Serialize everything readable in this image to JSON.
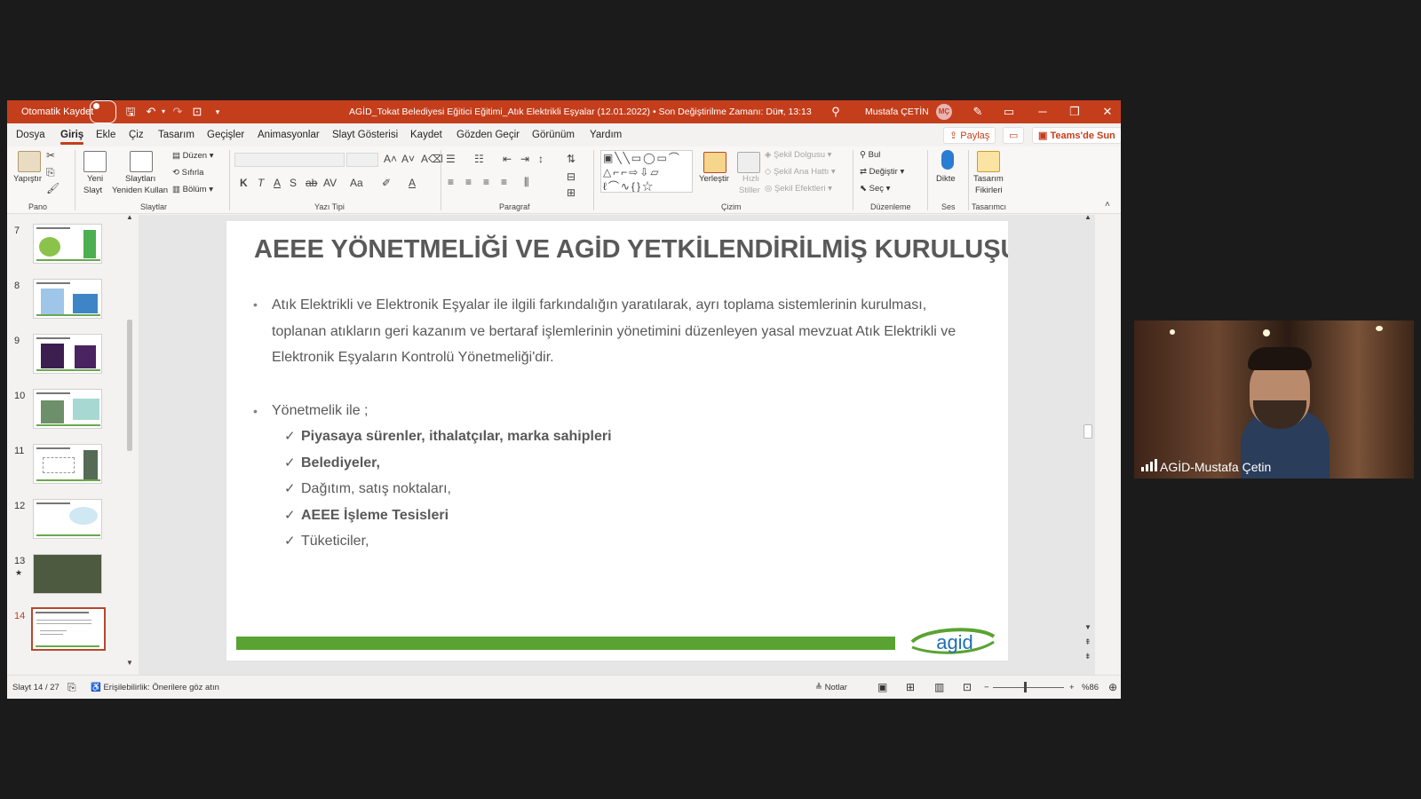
{
  "titlebar": {
    "autosave_label": "Otomatik Kaydet",
    "doc_title": "AGİD_Tokat Belediyesi Eğitici Eğitimi_Atık Elektrikli Eşyalar (12.01.2022) • Son Değiştirilme Zamanı: Dün, 13:13",
    "user_name": "Mustafa ÇETİN",
    "user_initials": "MÇ"
  },
  "menu": {
    "tabs": [
      "Dosya",
      "Giriş",
      "Ekle",
      "Çiz",
      "Tasarım",
      "Geçişler",
      "Animasyonlar",
      "Slayt Gösterisi",
      "Kaydet",
      "Gözden Geçir",
      "Görünüm",
      "Yardım"
    ],
    "share_label": "Paylaş",
    "teams_label": "Teams'de Sun"
  },
  "ribbon": {
    "paste_label": "Yapıştır",
    "new_slide_l1": "Yeni",
    "new_slide_l2": "Slayt",
    "reuse_l1": "Slaytları",
    "reuse_l2": "Yeniden Kullan",
    "layout_label": "Düzen",
    "reset_label": "Sıfırla",
    "section_label": "Bölüm",
    "shape_fill": "Şekil Dolgusu",
    "shape_outline": "Şekil Ana Hattı",
    "shape_effects": "Şekil Efektleri",
    "arrange_label": "Yerleştir",
    "quick_styles_l1": "Hızlı",
    "quick_styles_l2": "Stiller",
    "find_label": "Bul",
    "replace_label": "Değiştir",
    "select_label": "Seç",
    "dictate_label": "Dikte",
    "designer_l1": "Tasarım",
    "designer_l2": "Fikirleri",
    "groups": {
      "pano": "Pano",
      "slaytlar": "Slaytlar",
      "yazi_tipi": "Yazı Tipi",
      "paragraf": "Paragraf",
      "cizim": "Çizim",
      "duzenleme": "Düzenleme",
      "ses": "Ses",
      "tasarimci": "Tasarımcı"
    }
  },
  "thumbnails": [
    {
      "num": "7"
    },
    {
      "num": "8"
    },
    {
      "num": "9"
    },
    {
      "num": "10"
    },
    {
      "num": "11"
    },
    {
      "num": "12"
    },
    {
      "num": "13"
    },
    {
      "num": "14"
    }
  ],
  "slide": {
    "title": "AEEE YÖNETMELİĞİ VE AGİD YETKİLENDİRİLMİŞ KURULUŞU",
    "bullet1_line1": "Atık Elektrikli ve Elektronik Eşyalar ile ilgili farkındalığın yaratılarak, ayrı toplama sistemlerinin kurulması,",
    "bullet1_line2": "toplanan atıkların geri kazanım ve bertaraf işlemlerinin yönetimini düzenleyen yasal mevzuat Atık Elektrikli ve",
    "bullet1_line3": "Elektronik Eşyaların Kontrolü Yönetmeliği'dir.",
    "bullet2": "Yönetmelik ile ;",
    "subitems": [
      "Piyasaya sürenler, ithalatçılar, marka sahipleri",
      "Belediyeler,",
      "Dağıtım, satış noktaları,",
      "AEEE İşleme Tesisleri",
      "Tüketiciler,"
    ],
    "logo_text": "agid"
  },
  "status": {
    "slide_counter": "Slayt 14 / 27",
    "accessibility": "Erişilebilirlik: Önerilere göz atın",
    "notes_label": "Notlar",
    "zoom": "%86"
  },
  "video": {
    "participant_name": "AGİD-Mustafa Çetin"
  },
  "colors": {
    "accent": "#c43e1c",
    "slide_green": "#5aa332",
    "logo_blue": "#1f6fb2"
  }
}
